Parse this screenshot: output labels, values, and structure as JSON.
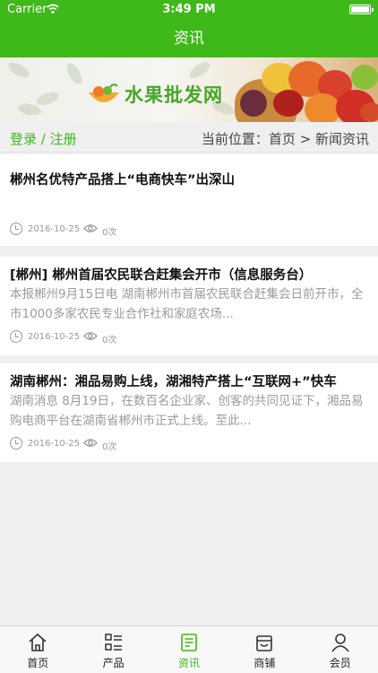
{
  "status_bar": {
    "carrier": "Carrier",
    "time": "3:49 PM"
  },
  "nav": {
    "title": "资讯"
  },
  "banner": {
    "logo_text": "水果批发网"
  },
  "sub_bar": {
    "login_link": "登录 / 注册",
    "breadcrumb": "当前位置：首页 > 新闻资讯"
  },
  "news": [
    {
      "title": "郴州名优特产品搭上“电商快车”出深山",
      "summary": "",
      "date": "2016-10-25",
      "views": "0次"
    },
    {
      "title": "[郴州] 郴州首届农民联合赶集会开市（信息服务台）",
      "summary": "本报郴州9月15日电 湖南郴州市首届农民联合赶集会日前开市，全市1000多家农民专业合作社和家庭农场...",
      "date": "2016-10-25",
      "views": "0次"
    },
    {
      "title": "湖南郴州：湘品易购上线，湖湘特产搭上“互联网+”快车",
      "summary": "湖南消息 8月19日，在数百名企业家、创客的共同见证下，湘品易购电商平台在湖南省郴州市正式上线。至此...",
      "date": "2016-10-25",
      "views": "0次"
    }
  ],
  "tabs": [
    {
      "label": "首页",
      "icon": "home-icon"
    },
    {
      "label": "产品",
      "icon": "list-icon"
    },
    {
      "label": "资讯",
      "icon": "news-icon",
      "active": true
    },
    {
      "label": "商铺",
      "icon": "shop-icon"
    },
    {
      "label": "会员",
      "icon": "user-icon"
    }
  ],
  "colors": {
    "brand_green": "#3fb819",
    "muted_text": "#9b9b9b"
  }
}
